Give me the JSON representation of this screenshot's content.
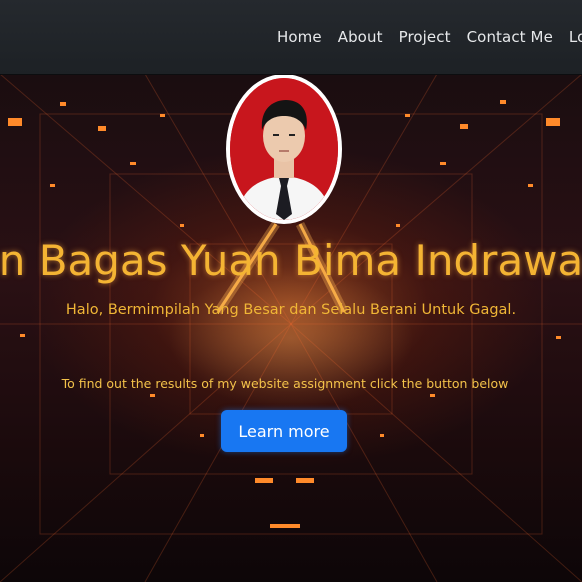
{
  "navbar": {
    "links": [
      "Home",
      "About",
      "Project",
      "Contact Me",
      "Logout"
    ]
  },
  "hero": {
    "title": "n Bagas Yuan Bima Indrawa",
    "subtitle": "Halo, Bermimpilah Yang Besar dan Selalu Berani Untuk Gagal.",
    "caption": "To find out the results of my website assignment click the button below",
    "button_label": "Learn more"
  },
  "colors": {
    "navbar_bg": "#23272b",
    "title": "#f4b433",
    "button": "#1877f2",
    "avatar_bg": "#c8161d"
  },
  "icons": {
    "avatar": "profile-photo"
  }
}
